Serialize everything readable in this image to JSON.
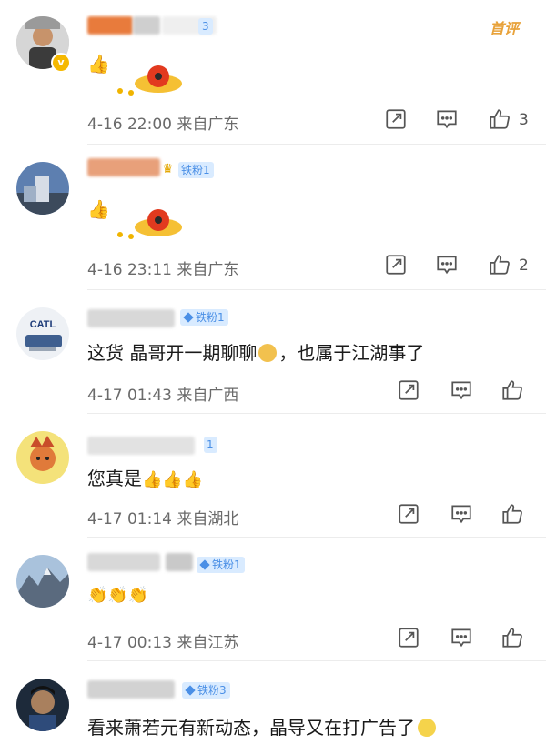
{
  "comments": [
    {
      "text": "",
      "meta": "4-16 22:00  来自广东",
      "likes": "3",
      "badge": "3",
      "first_tag": "首评"
    },
    {
      "text": "",
      "meta": "4-16 23:11  来自广东",
      "likes": "2",
      "badge": "铁粉1"
    },
    {
      "text": "这货 晶哥开一期聊聊",
      "text2": "，也属于江湖事了",
      "meta": "4-17 01:43  来自广西",
      "badge": "铁粉1"
    },
    {
      "text": "您真是",
      "meta": "4-17 01:14  来自湖北",
      "badge": "1"
    },
    {
      "text": "",
      "meta": "4-17 00:13  来自江苏",
      "badge": "铁粉1"
    },
    {
      "text": "看来萧若元有新动态，晶导又在打广告了",
      "badge": "铁粉3"
    }
  ],
  "icons": {
    "share": "share-icon",
    "comment": "comment-icon",
    "like": "thumbs-up-icon"
  },
  "colors": {
    "accent_orange": "#e8a23a",
    "fan_badge_bg": "#d9ebff",
    "fan_badge_text": "#4a8fe6",
    "meta_gray": "#6a6a6a"
  }
}
